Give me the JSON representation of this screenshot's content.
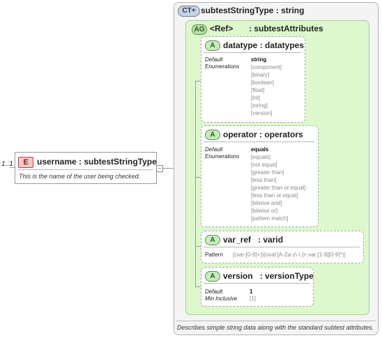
{
  "element": {
    "multiplicity": "1..1",
    "badge": "E",
    "title": "username : subtestStringType",
    "description": "This is the name of the user being checked."
  },
  "complex_type": {
    "badge": "CT",
    "title": "subtestStringType : string",
    "description": "Describes simple string data along with the standard subtest attributes."
  },
  "attribute_group": {
    "badge": "AG",
    "ref": "<Ref>",
    "title": ": subtestAttributes"
  },
  "attributes": [
    {
      "badge": "A",
      "title": "datatype : datatypes",
      "default_label": "Default",
      "default_value": "string",
      "enum_label": "Enumerations",
      "enumerations": [
        "[component]",
        "[binary]",
        "[boolean]",
        "[float]",
        "[int]",
        "[string]",
        "[version]"
      ]
    },
    {
      "badge": "A",
      "title": "operator : operators",
      "default_label": "Default",
      "default_value": "equals",
      "enum_label": "Enumerations",
      "enumerations": [
        "[equals]",
        "[not equal]",
        "[greater than]",
        "[less than]",
        "[greater than or equal]",
        "[less than or equal]",
        "[bitwise and]",
        "[bitwise or]",
        "[pattern match]"
      ]
    },
    {
      "badge": "A",
      "title": "var_ref   : varid",
      "pattern_label": "Pattern",
      "pattern_value": "[(var-[0-9]+)|(oval:[A-Za-z\\-\\.]+:var:[1-9][0-9]*)]"
    },
    {
      "badge": "A",
      "title": "version   : versionType",
      "default_label": "Default",
      "default_value": "1",
      "min_label": "Min Inclusive",
      "min_value": "[1]"
    }
  ],
  "colors": {
    "element_badge": "#f6c9c9",
    "complex_type_bg": "#f4f4f4",
    "attribute_group_bg": "#dcf8cc",
    "attribute_badge": "#c6ecc0"
  }
}
